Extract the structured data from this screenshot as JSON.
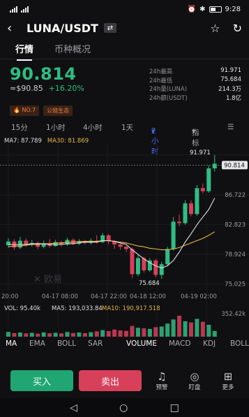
{
  "status_bar": {
    "signal_left": "▮▮",
    "time": "9:28"
  },
  "header": {
    "pair": "LUNA/USDT",
    "swap_icon": "swap-icon"
  },
  "tabs": [
    {
      "label": "行情"
    },
    {
      "label": "币种概况"
    }
  ],
  "ticker": {
    "price": "90.814",
    "fiat_price": "≈$90.85",
    "change": "+16.20%",
    "stats": [
      {
        "label": "24h最高",
        "value": "91.971"
      },
      {
        "label": "24h最低",
        "value": "75.684"
      },
      {
        "label": "24h量(LUNA)",
        "value": "214.3万"
      },
      {
        "label": "24h额(USDT)",
        "value": "1.8亿"
      }
    ]
  },
  "tags": [
    {
      "label": "NO.7"
    },
    {
      "label": "公链生态"
    }
  ],
  "intervals": [
    "15分",
    "1小时",
    "4小时",
    "1天",
    "2小时",
    "指标"
  ],
  "ma_legend": {
    "ma7": "MA7: 87.789",
    "ma30": "MA30: 81.869"
  },
  "colors": {
    "up": "#2ebd85",
    "down": "#d8405a",
    "ma7": "#e0e0e4",
    "ma30": "#e8b545",
    "accent": "#4b6bff"
  },
  "chart_data": {
    "type": "candlestick",
    "interval": "2小时",
    "y_tick_labels": [
      "91.971",
      "86.722",
      "82.823",
      "78.924",
      "75.025"
    ],
    "current_price_label": "90.814",
    "high_label": "91.971",
    "low_label": "75.684",
    "x_tick_labels": [
      "20:00",
      "04-17 08:00",
      "04-17 22:00",
      "04-18 12:00",
      "04-19 02:00"
    ],
    "watermark": "欧易",
    "candles": [
      {
        "o": 80.1,
        "c": 80.6,
        "h": 81.0,
        "l": 79.8
      },
      {
        "o": 80.6,
        "c": 79.8,
        "h": 80.9,
        "l": 79.5
      },
      {
        "o": 79.8,
        "c": 80.7,
        "h": 81.2,
        "l": 79.6
      },
      {
        "o": 80.7,
        "c": 80.2,
        "h": 81.0,
        "l": 79.9
      },
      {
        "o": 80.2,
        "c": 80.4,
        "h": 80.8,
        "l": 79.9
      },
      {
        "o": 80.4,
        "c": 79.9,
        "h": 80.6,
        "l": 79.6
      },
      {
        "o": 79.9,
        "c": 80.3,
        "h": 80.7,
        "l": 79.7
      },
      {
        "o": 80.3,
        "c": 80.0,
        "h": 80.9,
        "l": 79.8
      },
      {
        "o": 80.0,
        "c": 80.5,
        "h": 80.8,
        "l": 79.9
      },
      {
        "o": 80.5,
        "c": 80.2,
        "h": 80.7,
        "l": 79.9
      },
      {
        "o": 80.2,
        "c": 80.8,
        "h": 81.1,
        "l": 80.0
      },
      {
        "o": 80.8,
        "c": 80.3,
        "h": 81.0,
        "l": 80.1
      },
      {
        "o": 80.3,
        "c": 80.6,
        "h": 80.9,
        "l": 80.1
      },
      {
        "o": 80.6,
        "c": 80.4,
        "h": 80.8,
        "l": 80.2
      },
      {
        "o": 80.4,
        "c": 80.7,
        "h": 81.0,
        "l": 80.2
      },
      {
        "o": 80.7,
        "c": 80.5,
        "h": 81.4,
        "l": 80.3
      },
      {
        "o": 80.5,
        "c": 81.4,
        "h": 81.7,
        "l": 80.4
      },
      {
        "o": 81.4,
        "c": 80.6,
        "h": 81.6,
        "l": 80.2
      },
      {
        "o": 80.6,
        "c": 80.2,
        "h": 80.8,
        "l": 79.6
      },
      {
        "o": 80.2,
        "c": 79.9,
        "h": 80.3,
        "l": 79.5
      },
      {
        "o": 79.9,
        "c": 79.6,
        "h": 80.0,
        "l": 79.2
      },
      {
        "o": 79.6,
        "c": 76.3,
        "h": 79.8,
        "l": 75.8
      },
      {
        "o": 76.3,
        "c": 78.4,
        "h": 78.8,
        "l": 76.0
      },
      {
        "o": 78.4,
        "c": 76.8,
        "h": 78.6,
        "l": 76.5
      },
      {
        "o": 76.8,
        "c": 78.1,
        "h": 78.4,
        "l": 76.6
      },
      {
        "o": 78.1,
        "c": 76.2,
        "h": 78.3,
        "l": 75.9
      },
      {
        "o": 76.2,
        "c": 77.6,
        "h": 77.9,
        "l": 75.684
      },
      {
        "o": 77.6,
        "c": 79.6,
        "h": 79.9,
        "l": 77.4
      },
      {
        "o": 79.6,
        "c": 83.2,
        "h": 83.8,
        "l": 79.4
      },
      {
        "o": 83.2,
        "c": 83.0,
        "h": 84.1,
        "l": 82.6
      },
      {
        "o": 83.0,
        "c": 85.6,
        "h": 86.0,
        "l": 82.8
      },
      {
        "o": 85.6,
        "c": 84.2,
        "h": 86.0,
        "l": 83.9
      },
      {
        "o": 84.2,
        "c": 87.6,
        "h": 88.0,
        "l": 84.0
      },
      {
        "o": 87.6,
        "c": 87.2,
        "h": 88.2,
        "l": 86.9
      },
      {
        "o": 87.2,
        "c": 90.2,
        "h": 90.6,
        "l": 87.0
      },
      {
        "o": 90.2,
        "c": 90.814,
        "h": 91.971,
        "l": 89.8
      }
    ],
    "ma7": [
      80.2,
      80.2,
      80.2,
      80.2,
      80.3,
      80.3,
      80.3,
      80.2,
      80.2,
      80.2,
      80.3,
      80.3,
      80.4,
      80.5,
      80.5,
      80.5,
      80.7,
      80.7,
      80.6,
      80.4,
      80.2,
      79.5,
      78.9,
      78.3,
      77.8,
      77.4,
      77.1,
      77.4,
      78.1,
      79.2,
      80.5,
      81.6,
      82.8,
      83.8,
      84.8,
      86.3
    ],
    "ma30": [
      79.9,
      80.0,
      80.0,
      80.1,
      80.2,
      80.2,
      80.3,
      80.3,
      80.4,
      80.4,
      80.5,
      80.5,
      80.6,
      80.6,
      80.6,
      80.6,
      80.7,
      80.7,
      80.6,
      80.5,
      80.4,
      80.2,
      80.0,
      79.9,
      79.7,
      79.6,
      79.5,
      79.5,
      79.6,
      79.8,
      80.1,
      80.4,
      80.7,
      81.0,
      81.4,
      81.869
    ],
    "volume_legend": {
      "vol": "VOL: 95.40k",
      "ma5": "MA5: 193,033.84",
      "ma10": "MA10: 190,917.518"
    },
    "volume_max_label": "352.42k",
    "volumes": [
      80,
      60,
      70,
      55,
      65,
      50,
      72,
      58,
      66,
      54,
      78,
      62,
      70,
      58,
      75,
      90,
      110,
      95,
      120,
      105,
      98,
      180,
      150,
      140,
      130,
      160,
      170,
      220,
      290,
      352,
      260,
      240,
      300,
      250,
      200,
      95.4
    ]
  },
  "tech_indicators": [
    "MA",
    "EMA",
    "BOLL",
    "SAR",
    "VOLUME",
    "MACD",
    "KDJ",
    "BOLL"
  ],
  "bottom": {
    "buy": "买入",
    "sell": "卖出",
    "alert": "预警",
    "watch": "盯盘",
    "more": "更多"
  },
  "nav": {
    "back": "◁",
    "home": "○",
    "recent": "□"
  }
}
